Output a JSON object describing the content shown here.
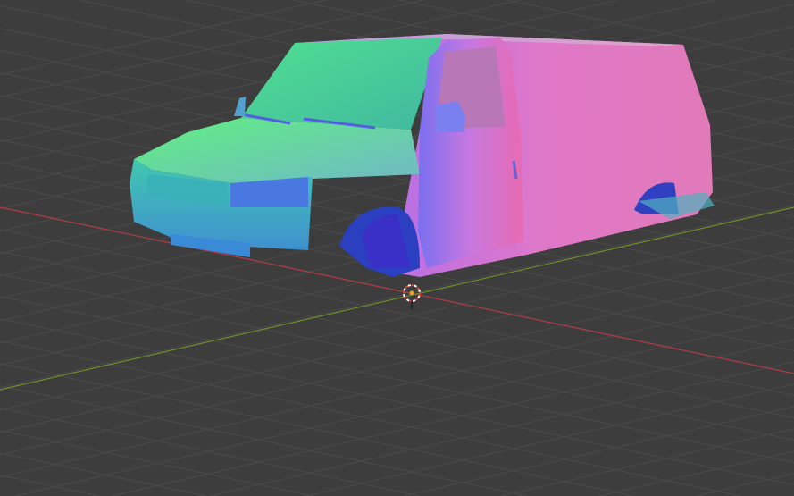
{
  "viewport": {
    "background_color": "#3d3d3d",
    "grid_color": "#4a4a4a",
    "x_axis_color": "#b03a44",
    "y_axis_color": "#6e8f2a",
    "shading": "normal-map"
  },
  "object": {
    "icon": "van-mesh",
    "origin_icon": "3d-cursor-icon"
  }
}
